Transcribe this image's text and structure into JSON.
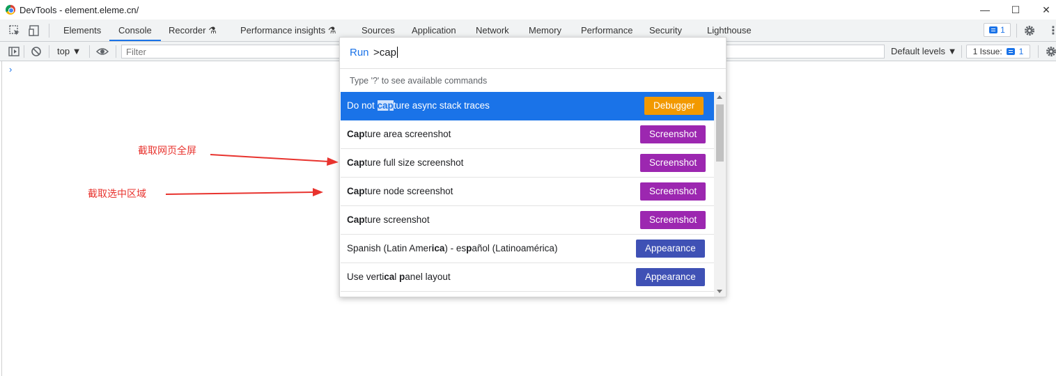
{
  "window": {
    "title": "DevTools - element.eleme.cn/",
    "minimize_glyph": "—",
    "maximize_glyph": "☐",
    "close_glyph": "✕"
  },
  "tabs": [
    {
      "label": "Elements"
    },
    {
      "label": "Console",
      "active": true
    },
    {
      "label": "Recorder ⚗"
    },
    {
      "label": "Performance insights ⚗"
    },
    {
      "label": "Sources"
    },
    {
      "label": "Application"
    },
    {
      "label": "Network"
    },
    {
      "label": "Memory"
    },
    {
      "label": "Performance"
    },
    {
      "label": "Security"
    },
    {
      "label": "Lighthouse"
    }
  ],
  "tabbar_right": {
    "messages_count": "1",
    "more_glyph": "⋮"
  },
  "console_toolbar": {
    "context": "top ▼",
    "filter_placeholder": "Filter",
    "levels": "Default levels ▼",
    "issues_label": "1 Issue:",
    "issues_count": "1"
  },
  "console": {
    "prompt": "›"
  },
  "command_menu": {
    "run_label": "Run",
    "query": ">cap",
    "hint": "Type '?' to see available commands",
    "items": [
      {
        "pre": "Do not ",
        "bold": "cap",
        "post": "ture async stack traces",
        "tag": "Debugger",
        "tag_color": "#f29900",
        "selected": true
      },
      {
        "pre": "",
        "bold": "Cap",
        "post": "ture area screenshot",
        "tag": "Screenshot",
        "tag_color": "#9c27b0"
      },
      {
        "pre": "",
        "bold": "Cap",
        "post": "ture full size screenshot",
        "tag": "Screenshot",
        "tag_color": "#9c27b0"
      },
      {
        "pre": "",
        "bold": "Cap",
        "post": "ture node screenshot",
        "tag": "Screenshot",
        "tag_color": "#9c27b0"
      },
      {
        "pre": "",
        "bold": "Cap",
        "post": "ture screenshot",
        "tag": "Screenshot",
        "tag_color": "#9c27b0"
      },
      {
        "pre": "Spanish (Latin Amer",
        "bold": "ica",
        "post": ") - es",
        "bold2": "p",
        "post2": "añol (Latinoamérica)",
        "tag": "Appearance",
        "tag_color": "#3f51b5"
      },
      {
        "pre": "Use verti",
        "bold": "ca",
        "post": "l ",
        "bold2": "p",
        "post2": "anel layout",
        "tag": "Appearance",
        "tag_color": "#3f51b5"
      }
    ],
    "partial_tag_color": "#34a853"
  },
  "annotations": {
    "full_page": "截取网页全屏",
    "selected_area": "截取选中区域",
    "color": "#e8332e"
  }
}
